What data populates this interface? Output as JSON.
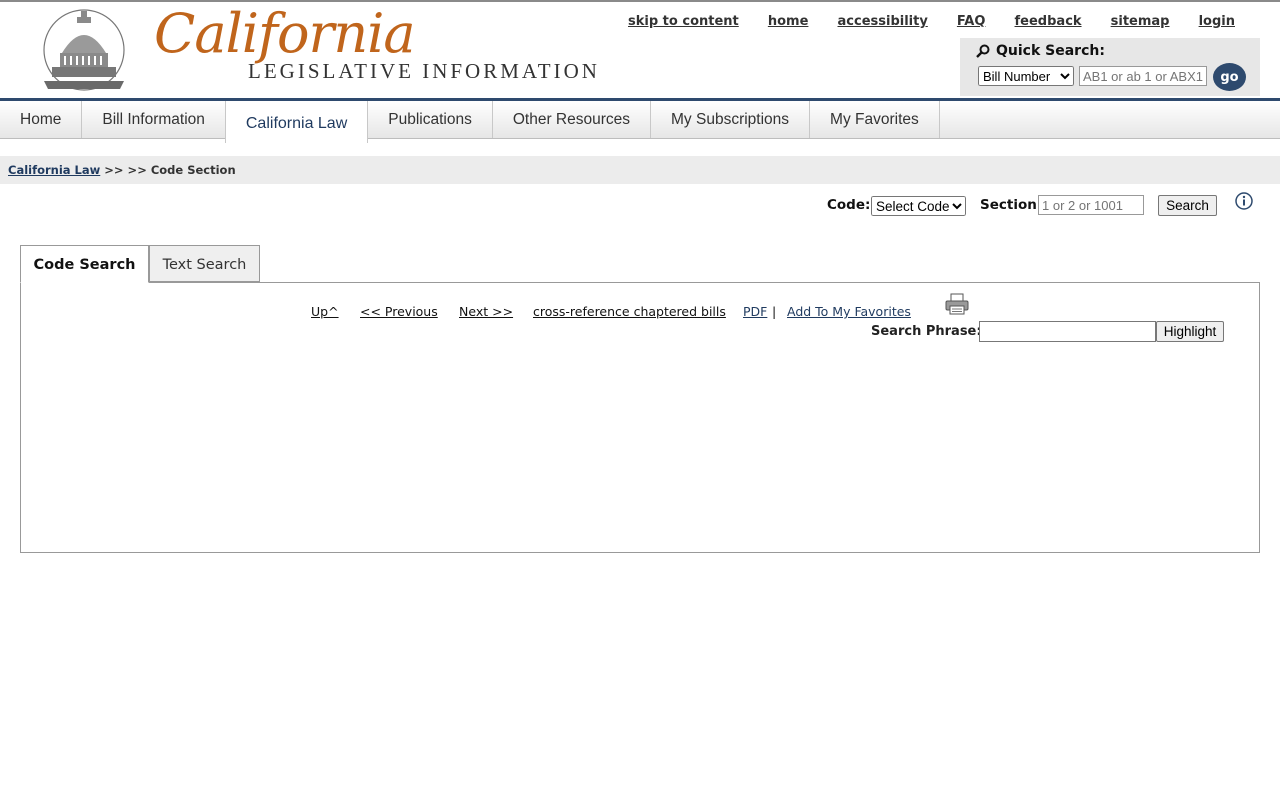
{
  "header": {
    "logo_script": "California",
    "logo_subtitle": "LEGISLATIVE INFORMATION",
    "top_links": [
      "skip to content",
      "home",
      "accessibility",
      "FAQ",
      "feedback",
      "sitemap",
      "login"
    ]
  },
  "quick_search": {
    "label": "Quick Search:",
    "select_value": "Bill Number",
    "input_placeholder": "AB1 or ab 1 or ABX1",
    "go_label": "go"
  },
  "nav": {
    "items": [
      "Home",
      "Bill Information",
      "California Law",
      "Publications",
      "Other Resources",
      "My Subscriptions",
      "My Favorites"
    ],
    "active": "California Law"
  },
  "breadcrumb": {
    "root_link": "California Law",
    "rest": ">> >> Code Section"
  },
  "code_search": {
    "code_label": "Code:",
    "code_select_value": "Select Code",
    "section_label": "Section:",
    "section_placeholder": "1 or 2 or 1001",
    "search_button": "Search"
  },
  "tabs": [
    "Code Search",
    "Text Search"
  ],
  "doc_toolbar": {
    "up": "Up^",
    "previous": "<< Previous",
    "next": "Next >>",
    "cross_reference": "cross-reference chaptered bills",
    "pdf": "PDF",
    "separator": "|",
    "add_favorites": "Add To My Favorites"
  },
  "phrase_search": {
    "label": "Search Phrase:",
    "value": "",
    "button": "Highlight"
  },
  "colors": {
    "brand_orange": "#c0651c",
    "nav_blue": "#2e4a6e"
  }
}
